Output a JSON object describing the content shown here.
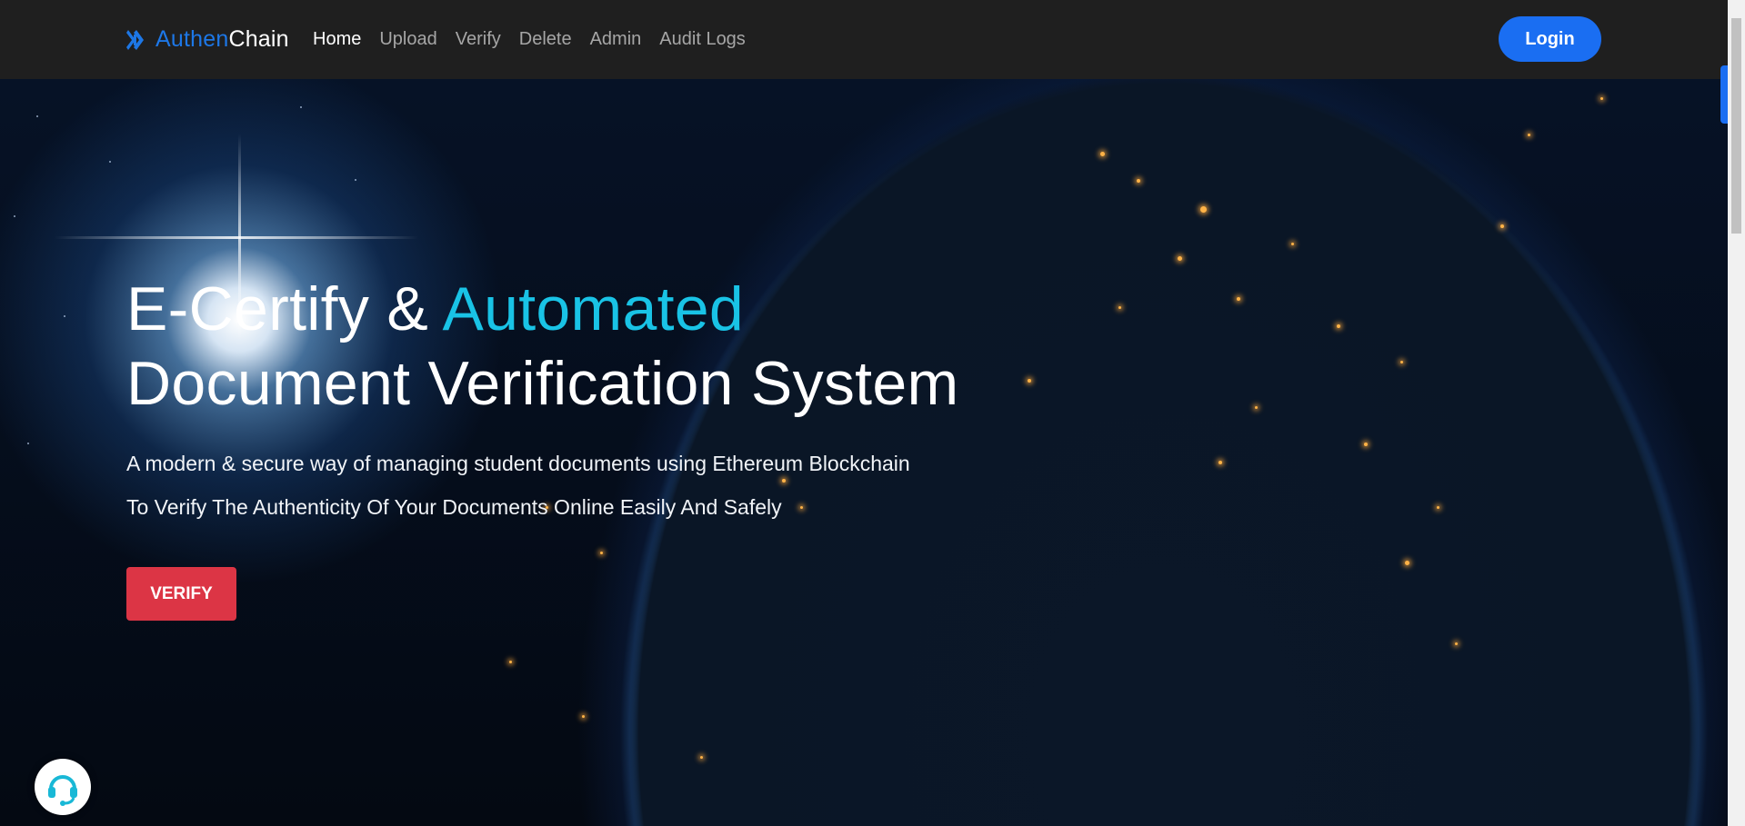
{
  "brand": {
    "part1": "Authen",
    "part2": "Chain",
    "icon": "double-chevron-logo-icon"
  },
  "nav": {
    "items": [
      {
        "label": "Home",
        "active": true
      },
      {
        "label": "Upload",
        "active": false
      },
      {
        "label": "Verify",
        "active": false
      },
      {
        "label": "Delete",
        "active": false
      },
      {
        "label": "Admin",
        "active": false
      },
      {
        "label": "Audit Logs",
        "active": false
      }
    ],
    "login_label": "Login"
  },
  "hero": {
    "title_part1": "E-Certify & ",
    "title_accent": "Automated",
    "title_line2": "Document Verification System",
    "subtitle1": "A modern & secure way of managing student documents using Ethereum Blockchain",
    "subtitle2": "To Verify The Authenticity Of Your Documents Online Easily And Safely",
    "cta_label": "VERIFY"
  },
  "chat_widget": {
    "icon": "headset-support-icon"
  },
  "colors": {
    "navbar_bg": "#1f1f1f",
    "brand_blue": "#1d77e6",
    "accent_cyan": "#19c3e6",
    "login_blue": "#1a6ef2",
    "verify_red": "#dc3545"
  }
}
